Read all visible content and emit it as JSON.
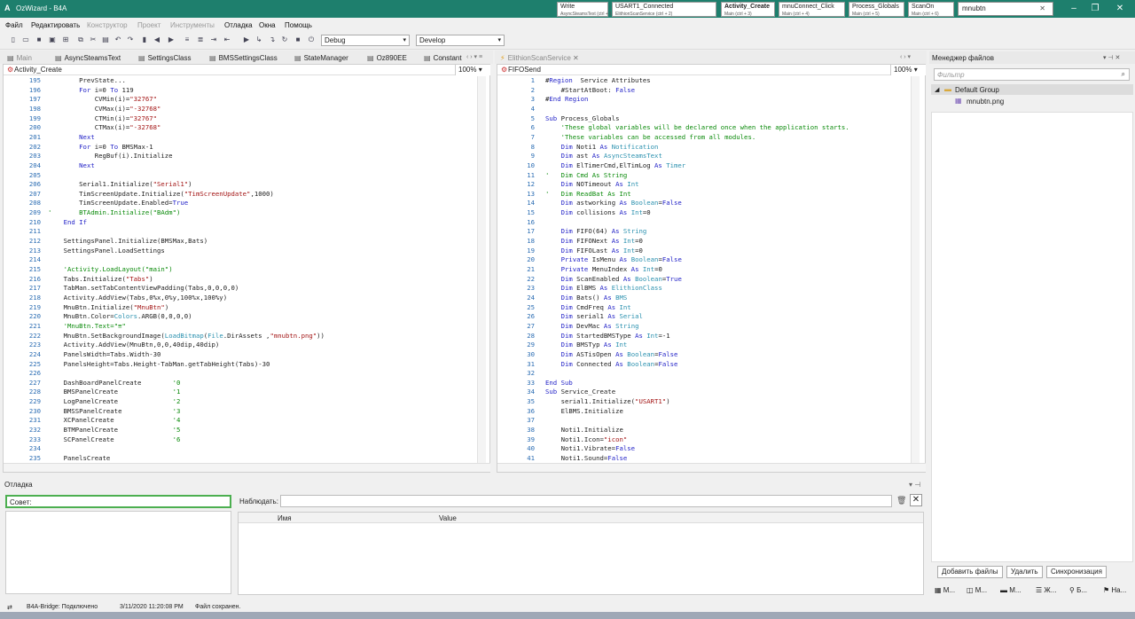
{
  "window": {
    "title": "OzWizard - B4A"
  },
  "quick_tabs": [
    {
      "main": "Write",
      "sub": "AsyncSteamsText  (ctrl + 1)",
      "active": false
    },
    {
      "main": "USART1_Connected",
      "sub": "ElithionScanService  (ctrl + 2)",
      "active": false
    },
    {
      "main": "Activity_Create",
      "sub": "Main  (ctrl + 3)",
      "active": true
    },
    {
      "main": "mnuConnect_Click",
      "sub": "Main  (ctrl + 4)",
      "active": false
    },
    {
      "main": "Process_Globals",
      "sub": "Main  (ctrl + 5)",
      "active": false
    },
    {
      "main": "ScanOn",
      "sub": "Main  (ctrl + 6)",
      "active": false
    }
  ],
  "search": {
    "value": "mnubtn"
  },
  "menu": [
    "Файл",
    "Редактировать",
    "Конструктор",
    "Проект",
    "Инструменты",
    "Отладка",
    "Окна",
    "Помощь"
  ],
  "toolbar": {
    "build_config": "Debug",
    "build_type": "Develop"
  },
  "left_editor": {
    "tabs": [
      "Main",
      "AsyncSteamsText",
      "SettingsClass",
      "BMSSettingsClass",
      "StateManager",
      "Oz890EE",
      "Constant"
    ],
    "module": "Activity_Create",
    "zoom": "100%",
    "lines": [
      {
        "n": "195",
        "t": "        PrevState..."
      },
      {
        "n": "196",
        "t": "        For i=0 To 119"
      },
      {
        "n": "197",
        "t": "            CVMin(i)=\"32767\""
      },
      {
        "n": "198",
        "t": "            CVMax(i)=\"-32768\""
      },
      {
        "n": "199",
        "t": "            CTMin(i)=\"32767\""
      },
      {
        "n": "200",
        "t": "            CTMax(i)=\"-32768\""
      },
      {
        "n": "201",
        "t": "        Next"
      },
      {
        "n": "202",
        "t": "        For i=0 To BMSMax-1"
      },
      {
        "n": "203",
        "t": "            RegBuf(i).Initialize"
      },
      {
        "n": "204",
        "t": "        Next"
      },
      {
        "n": "205",
        "t": ""
      },
      {
        "n": "206",
        "t": "        Serial1.Initialize(\"Serial1\")"
      },
      {
        "n": "207",
        "t": "        TimScreenUpdate.Initialize(\"TimScreenUpdate\",1000)"
      },
      {
        "n": "208",
        "t": "        TimScreenUpdate.Enabled=True"
      },
      {
        "n": "209",
        "t": "'       BTAdmin.Initialize(\"BAdm\")"
      },
      {
        "n": "210",
        "t": "    End If"
      },
      {
        "n": "211",
        "t": ""
      },
      {
        "n": "212",
        "t": "    SettingsPanel.Initialize(BMSMax,Bats)"
      },
      {
        "n": "213",
        "t": "    SettingsPanel.LoadSettings"
      },
      {
        "n": "214",
        "t": ""
      },
      {
        "n": "215",
        "t": "    'Activity.LoadLayout(\"main\")"
      },
      {
        "n": "216",
        "t": "    Tabs.Initialize(\"Tabs\")"
      },
      {
        "n": "217",
        "t": "    TabMan.setTabContentViewPadding(Tabs,0,0,0,0)"
      },
      {
        "n": "218",
        "t": "    Activity.AddView(Tabs,0%x,0%y,100%x,100%y)"
      },
      {
        "n": "219",
        "t": "    MnuBtn.Initialize(\"MnuBtn\")"
      },
      {
        "n": "220",
        "t": "    MnuBtn.Color=Colors.ARGB(0,0,0,0)"
      },
      {
        "n": "221",
        "t": "    'MnuBtn.Text=\"≡\""
      },
      {
        "n": "222",
        "t": "    MnuBtn.SetBackgroundImage(LoadBitmap(File.DirAssets ,\"mnubtn.png\"))"
      },
      {
        "n": "223",
        "t": "    Activity.AddView(MnuBtn,0,0,40dip,40dip)"
      },
      {
        "n": "224",
        "t": "    PanelsWidth=Tabs.Width-30"
      },
      {
        "n": "225",
        "t": "    PanelsHeight=Tabs.Height-TabMan.getTabHeight(Tabs)-30"
      },
      {
        "n": "226",
        "t": ""
      },
      {
        "n": "227",
        "t": "    DashBoardPanelCreate        '0"
      },
      {
        "n": "228",
        "t": "    BMSPanelCreate              '1"
      },
      {
        "n": "229",
        "t": "    LogPanelCreate              '2"
      },
      {
        "n": "230",
        "t": "    BMSSPanelCreate             '3"
      },
      {
        "n": "231",
        "t": "    XCPanelCreate               '4"
      },
      {
        "n": "232",
        "t": "    BTMPanelCreate              '5"
      },
      {
        "n": "233",
        "t": "    SCPanelCreate               '6"
      },
      {
        "n": "234",
        "t": ""
      },
      {
        "n": "235",
        "t": "    PanelsCreate"
      }
    ]
  },
  "right_editor": {
    "tabs": [
      "ElithionScanService"
    ],
    "module": "FIFOSend",
    "zoom": "100%",
    "lines": [
      {
        "n": "1",
        "t": "#Region  Service Attributes"
      },
      {
        "n": "2",
        "t": "    #StartAtBoot: False"
      },
      {
        "n": "3",
        "t": "#End Region"
      },
      {
        "n": "4",
        "t": ""
      },
      {
        "n": "5",
        "t": "Sub Process_Globals"
      },
      {
        "n": "6",
        "t": "    'These global variables will be declared once when the application starts."
      },
      {
        "n": "7",
        "t": "    'These variables can be accessed from all modules."
      },
      {
        "n": "8",
        "t": "    Dim Noti1 As Notification"
      },
      {
        "n": "9",
        "t": "    Dim ast As AsyncSteamsText"
      },
      {
        "n": "10",
        "t": "    Dim ElTimerCmd,ElTimLog As Timer"
      },
      {
        "n": "11",
        "t": "'   Dim Cmd As String"
      },
      {
        "n": "12",
        "t": "    Dim NOTimeout As Int"
      },
      {
        "n": "13",
        "t": "'   Dim ReadBat As Int"
      },
      {
        "n": "14",
        "t": "    Dim astworking As Boolean=False"
      },
      {
        "n": "15",
        "t": "    Dim collisions As Int=0"
      },
      {
        "n": "16",
        "t": ""
      },
      {
        "n": "17",
        "t": "    Dim FIFO(64) As String"
      },
      {
        "n": "18",
        "t": "    Dim FIFONext As Int=0"
      },
      {
        "n": "19",
        "t": "    Dim FIFOLast As Int=0"
      },
      {
        "n": "20",
        "t": "    Private IsMenu As Boolean=False"
      },
      {
        "n": "21",
        "t": "    Private MenuIndex As Int=0"
      },
      {
        "n": "22",
        "t": "    Dim ScanEnabled As Boolean=True"
      },
      {
        "n": "23",
        "t": "    Dim ElBMS As ElithionClass"
      },
      {
        "n": "24",
        "t": "    Dim Bats() As BMS"
      },
      {
        "n": "25",
        "t": "    Dim CmdFreq As Int"
      },
      {
        "n": "26",
        "t": "    Dim serial1 As Serial"
      },
      {
        "n": "27",
        "t": "    Dim DevMac As String"
      },
      {
        "n": "28",
        "t": "    Dim StartedBMSType As Int=-1"
      },
      {
        "n": "29",
        "t": "    Dim BMSTyp As Int"
      },
      {
        "n": "30",
        "t": "    Dim ASTisOpen As Boolean=False"
      },
      {
        "n": "31",
        "t": "    Dim Connected As Boolean=False"
      },
      {
        "n": "32",
        "t": ""
      },
      {
        "n": "33",
        "t": "End Sub"
      },
      {
        "n": "34",
        "t": "Sub Service_Create"
      },
      {
        "n": "35",
        "t": "    serial1.Initialize(\"USART1\")"
      },
      {
        "n": "36",
        "t": "    ElBMS.Initialize"
      },
      {
        "n": "37",
        "t": ""
      },
      {
        "n": "38",
        "t": "    Noti1.Initialize"
      },
      {
        "n": "39",
        "t": "    Noti1.Icon=\"icon\""
      },
      {
        "n": "40",
        "t": "    Noti1.Vibrate=False"
      },
      {
        "n": "41",
        "t": "    Noti1.Sound=False"
      }
    ]
  },
  "debug": {
    "title": "Отладка",
    "hint_label": "Совет:",
    "watch_label": "Наблюдать:",
    "col_name": "Имя",
    "col_value": "Value"
  },
  "file_manager": {
    "title": "Менеджер файлов",
    "filter_placeholder": "Фильтр",
    "group": "Default Group",
    "file": "mnubtn.png",
    "btn_add": "Добавить файлы",
    "btn_delete": "Удалить",
    "btn_sync": "Синхронизация",
    "bottom_tabs": [
      "М...",
      "М...",
      "М...",
      "Ж...",
      "Б...",
      "На..."
    ]
  },
  "status": {
    "bridge": "B4A-Bridge: Подключено",
    "timestamp": "3/11/2020 11:20:08 PM",
    "saved": "Файл сохранен."
  },
  "colors": {
    "title_bar": "#1e7f6d",
    "keyword": "#2424c8",
    "string": "#a31515",
    "comment": "#0a8a0a",
    "type": "#2b91af"
  }
}
